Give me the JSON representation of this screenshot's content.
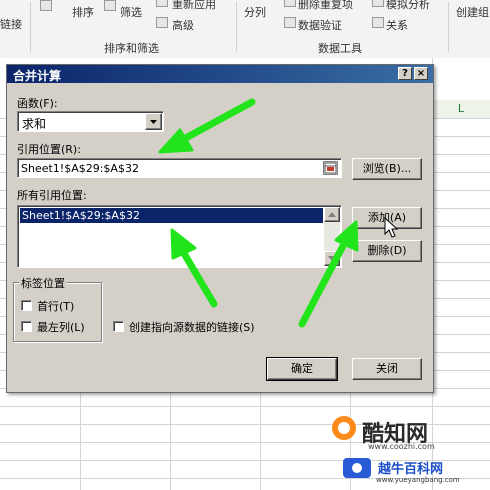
{
  "ribbon": {
    "row1": {
      "partial_left": "链接",
      "sort": "排序",
      "filter": "筛选",
      "reapply": "重新应用",
      "split_column": "分列",
      "remove_duplicates": "删除重复项",
      "whatif": "模拟分析",
      "create": "创建组"
    },
    "row2": {
      "advanced": "高级",
      "data_validation": "数据验证",
      "relationships": "关系"
    },
    "groups": {
      "sort_filter": "排序和筛选",
      "data_tools": "数据工具"
    }
  },
  "sheet": {
    "column_header": "L"
  },
  "dialog": {
    "title": "合并计算",
    "help_button": "?",
    "close_button": "×",
    "function_label": "函数(F):",
    "function_label_key": "F",
    "function_value": "求和",
    "reference_label": "引用位置(R):",
    "reference_value": "Sheet1!$A$29:$A$32",
    "browse_button": "浏览(B)...",
    "all_refs_label": "所有引用位置:",
    "all_refs_items": [
      "Sheet1!$A$29:$A$32"
    ],
    "add_button": "添加(A)",
    "delete_button": "删除(D)",
    "label_position_title": "标签位置",
    "first_row": "首行(T)",
    "left_column": "最左列(L)",
    "link_source": "创建指向源数据的链接(S)",
    "ok_button": "确定",
    "close_bottom_button": "关闭"
  },
  "watermark": {
    "title": "酷知网",
    "url": "www.coozhi.com",
    "site_name": "越牛百科网",
    "site_url": "www.yueyangbang.com"
  },
  "colors": {
    "arrow_green": "#22e41a",
    "title_bar": "#0a246a",
    "selection": "#0a246a"
  }
}
